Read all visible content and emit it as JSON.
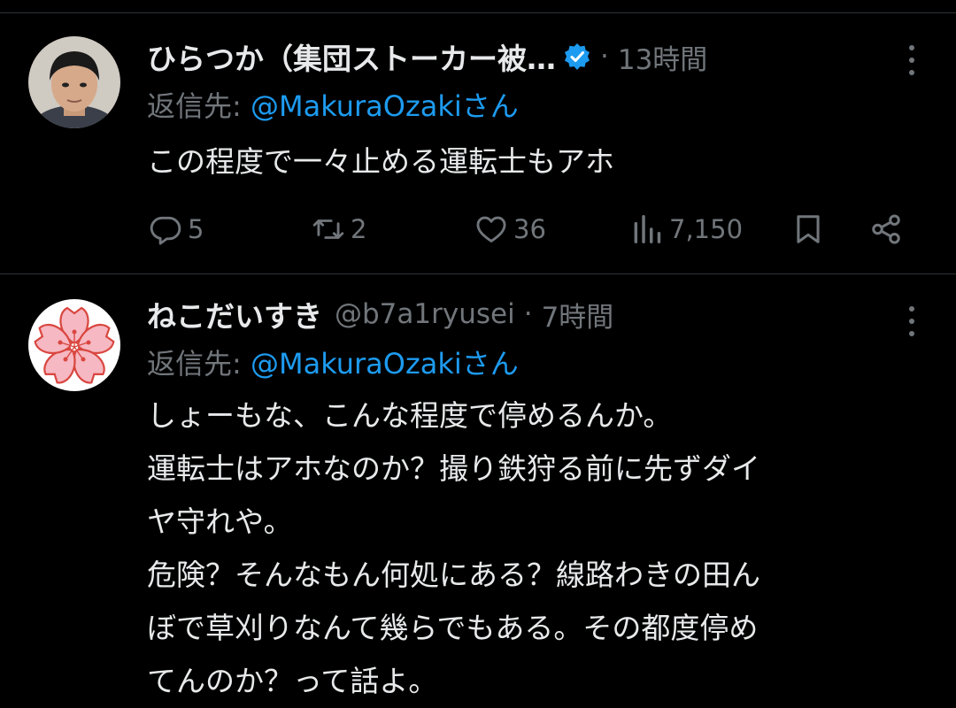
{
  "tweets": [
    {
      "name": "ひらつか（集団ストーカー被…",
      "verified": true,
      "handle": "",
      "dot": "·",
      "time": "13時間",
      "reply_prefix": "返信先: ",
      "reply_mention": "@MakuraOzaki",
      "reply_suffix": "さん",
      "text": "この程度で一々止める運転士もアホ",
      "actions": {
        "replies": "5",
        "retweets": "2",
        "likes": "36",
        "views": "7,150"
      }
    },
    {
      "name": "ねこだいすき",
      "verified": false,
      "handle": "@b7a1ryusei",
      "dot": "·",
      "time": "7時間",
      "reply_prefix": "返信先: ",
      "reply_mention": "@MakuraOzaki",
      "reply_suffix": "さん",
      "text": "しょーもな、こんな程度で停めるんか。\n運転士はアホなのか？撮り鉄狩る前に先ずダイ\nヤ守れや。\n危険？そんなもん何処にある？線路わきの田ん\nぼで草刈りなんて幾らでもある。その都度停め\nてんのか？って話よ。"
    }
  ],
  "colors": {
    "background": "#000000",
    "text": "#e7e9ea",
    "muted": "#71767b",
    "link": "#1d9bf0",
    "divider": "#2f3336",
    "verified_badge": "#1d9bf0"
  },
  "icons": {
    "verified": "verified-badge-icon",
    "more": "more-dots-icon",
    "reply": "reply-bubble-icon",
    "retweet": "retweet-icon",
    "like": "heart-icon",
    "views": "views-bar-chart-icon",
    "bookmark": "bookmark-icon",
    "share": "share-icon"
  }
}
